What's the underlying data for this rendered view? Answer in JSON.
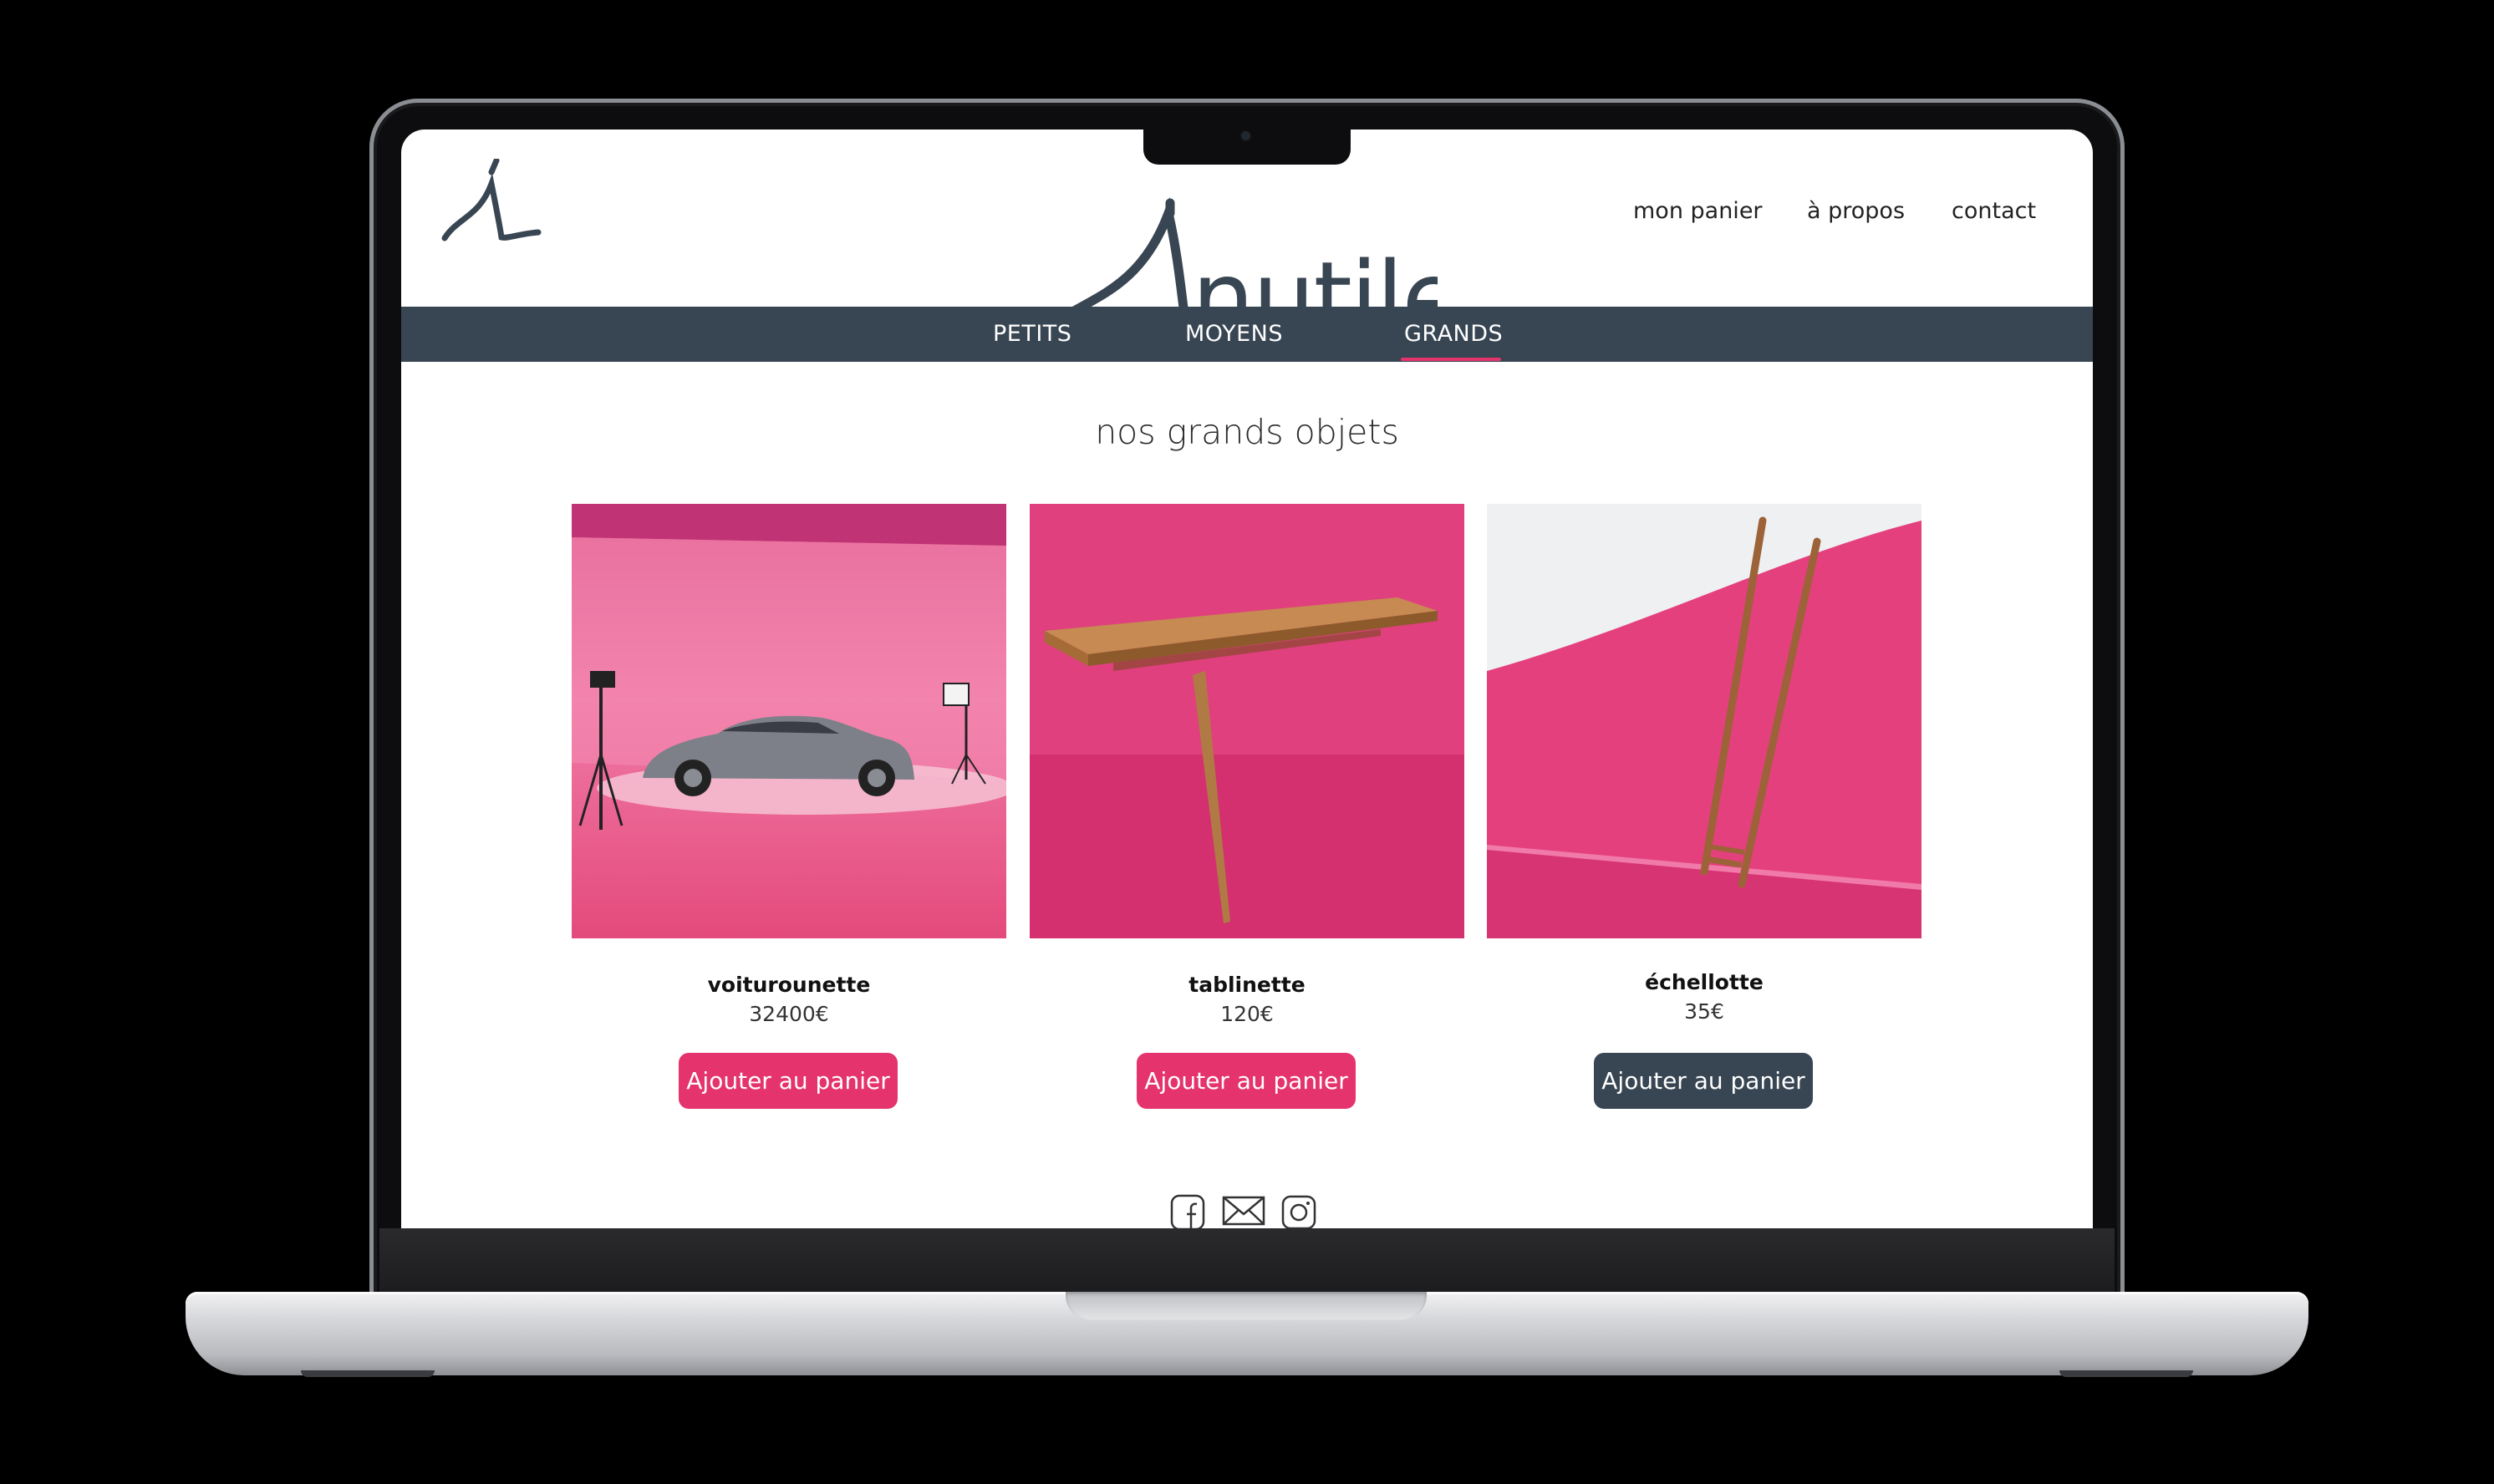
{
  "site": {
    "brand_initial": "i",
    "brand_name": "inutile",
    "top_nav": [
      "mon panier",
      "à propos",
      "contact"
    ],
    "categories": [
      "PETITS",
      "MOYENS",
      "GRANDS"
    ],
    "active_category": "GRANDS",
    "heading": "nos grands objets",
    "products": [
      {
        "name": "voiturounette",
        "price": "32400€",
        "button": "Ajouter au panier",
        "button_color": "#e5336d",
        "image": "grey-sedan-pink-studio"
      },
      {
        "name": "tablinette",
        "price": "120€",
        "button": "Ajouter au panier",
        "button_color": "#e5336d",
        "image": "wooden-table-pink-backdrop"
      },
      {
        "name": "échellotte",
        "price": "35€",
        "button": "Ajouter au panier",
        "button_color": "#384552",
        "image": "wooden-ladder-pink-wall"
      }
    ],
    "social_icons": [
      "facebook-icon",
      "mail-icon",
      "instagram-icon"
    ]
  },
  "colors": {
    "nav_bar": "#384552",
    "accent_pink": "#e5336d",
    "text_dark": "#2b2b2b"
  }
}
